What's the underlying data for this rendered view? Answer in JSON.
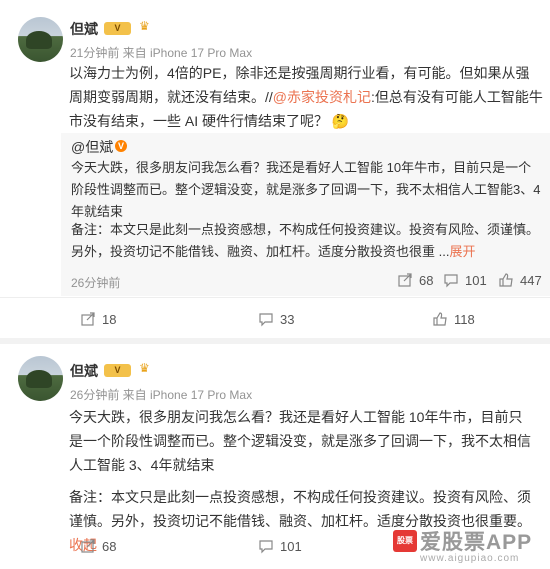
{
  "post1": {
    "user": "但斌",
    "vip_label": "V",
    "meta": "21分钟前  来自 iPhone 17 Pro Max",
    "text_before": "以海力士为例，4倍的PE，除非还是按强周期行业看，有可能。但如果从强周期变弱周期，就还没有结束。//",
    "mention": "@赤家投资札记",
    "text_after": ":但总有没有可能人工智能牛市没有结束，一些 AI 硬件行情结束了呢？",
    "emoji": "🤔",
    "quote": {
      "user": "@但斌",
      "text": "今天大跌，很多朋友问我怎么看？我还是看好人工智能 10年牛市，目前只是一个阶段性调整而已。整个逻辑没变，就是涨多了回调一下，我不太相信人工智能3、4年就结束",
      "note": "备注：本文只是此刻一点投资感想，不构成任何投资建议。投资有风险、须谨慎。另外，投资切记不能借钱、融资、加杠杆。适度分散投资也很重 ...",
      "expand": "展开",
      "time": "26分钟前",
      "share_count": "68",
      "comment_count": "101",
      "like_count": "447"
    },
    "share_count": "18",
    "comment_count": "33",
    "like_count": "118"
  },
  "post2": {
    "user": "但斌",
    "vip_label": "V",
    "meta": "26分钟前  来自 iPhone 17 Pro Max",
    "text": "今天大跌，很多朋友问我怎么看？我还是看好人工智能 10年牛市，目前只是一个阶段性调整而已。整个逻辑没变，就是涨多了回调一下，我不太相信人工智能 3、4年就结束",
    "note": "备注：本文只是此刻一点投资感想，不构成任何投资建议。投资有风险、须谨慎。另外，投资切记不能借钱、融资、加杠杆。适度分散投资也很重要。",
    "collapse": "收起",
    "share_count": "68",
    "comment_count": "101"
  },
  "watermark": {
    "logo": "股票",
    "brand": "爱股票APP",
    "url": "www.aigupiao.com"
  }
}
